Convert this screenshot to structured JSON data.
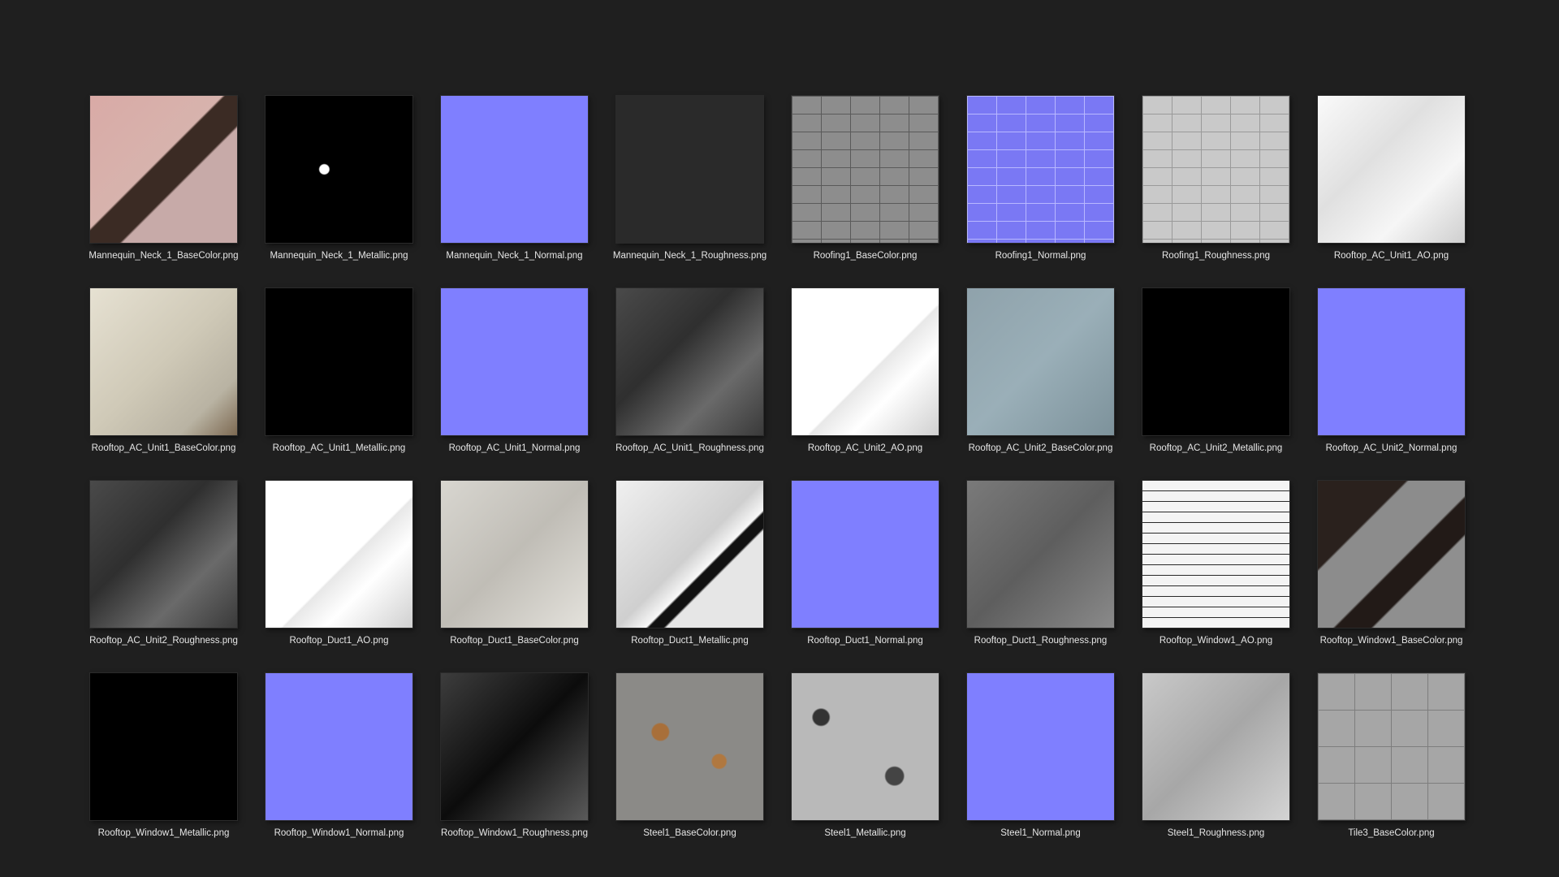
{
  "files": [
    {
      "name": "Mannequin_Neck_1_BaseColor.png",
      "swatch": "t-pink"
    },
    {
      "name": "Mannequin_Neck_1_Metallic.png",
      "swatch": "t-metal-spots"
    },
    {
      "name": "Mannequin_Neck_1_Normal.png",
      "swatch": "t-normal"
    },
    {
      "name": "Mannequin_Neck_1_Roughness.png",
      "swatch": "t-dark"
    },
    {
      "name": "Roofing1_BaseColor.png",
      "swatch": "t-roofing"
    },
    {
      "name": "Roofing1_Normal.png",
      "swatch": "t-roofing-normal"
    },
    {
      "name": "Roofing1_Roughness.png",
      "swatch": "t-roofing-rough"
    },
    {
      "name": "Rooftop_AC_Unit1_AO.png",
      "swatch": "t-ao"
    },
    {
      "name": "Rooftop_AC_Unit1_BaseColor.png",
      "swatch": "t-beige"
    },
    {
      "name": "Rooftop_AC_Unit1_Metallic.png",
      "swatch": "t-metal-mask"
    },
    {
      "name": "Rooftop_AC_Unit1_Normal.png",
      "swatch": "t-normal"
    },
    {
      "name": "Rooftop_AC_Unit1_Roughness.png",
      "swatch": "t-rough-gray"
    },
    {
      "name": "Rooftop_AC_Unit2_AO.png",
      "swatch": "t-white-ao"
    },
    {
      "name": "Rooftop_AC_Unit2_BaseColor.png",
      "swatch": "t-bluegray"
    },
    {
      "name": "Rooftop_AC_Unit2_Metallic.png",
      "swatch": "t-metal-mask"
    },
    {
      "name": "Rooftop_AC_Unit2_Normal.png",
      "swatch": "t-normal"
    },
    {
      "name": "Rooftop_AC_Unit2_Roughness.png",
      "swatch": "t-rough-gray"
    },
    {
      "name": "Rooftop_Duct1_AO.png",
      "swatch": "t-white-ao"
    },
    {
      "name": "Rooftop_Duct1_BaseColor.png",
      "swatch": "t-lightgray"
    },
    {
      "name": "Rooftop_Duct1_Metallic.png",
      "swatch": "t-whitegray"
    },
    {
      "name": "Rooftop_Duct1_Normal.png",
      "swatch": "t-normal"
    },
    {
      "name": "Rooftop_Duct1_Roughness.png",
      "swatch": "t-graystone"
    },
    {
      "name": "Rooftop_Window1_AO.png",
      "swatch": "t-lines-ao"
    },
    {
      "name": "Rooftop_Window1_BaseColor.png",
      "swatch": "t-window-base"
    },
    {
      "name": "Rooftop_Window1_Metallic.png",
      "swatch": "t-black"
    },
    {
      "name": "Rooftop_Window1_Normal.png",
      "swatch": "t-normal"
    },
    {
      "name": "Rooftop_Window1_Roughness.png",
      "swatch": "t-window-rough"
    },
    {
      "name": "Steel1_BaseColor.png",
      "swatch": "t-rust"
    },
    {
      "name": "Steel1_Metallic.png",
      "swatch": "t-speckle"
    },
    {
      "name": "Steel1_Normal.png",
      "swatch": "t-normal"
    },
    {
      "name": "Steel1_Roughness.png",
      "swatch": "t-steel-rough"
    },
    {
      "name": "Tile3_BaseColor.png",
      "swatch": "t-tile"
    }
  ]
}
